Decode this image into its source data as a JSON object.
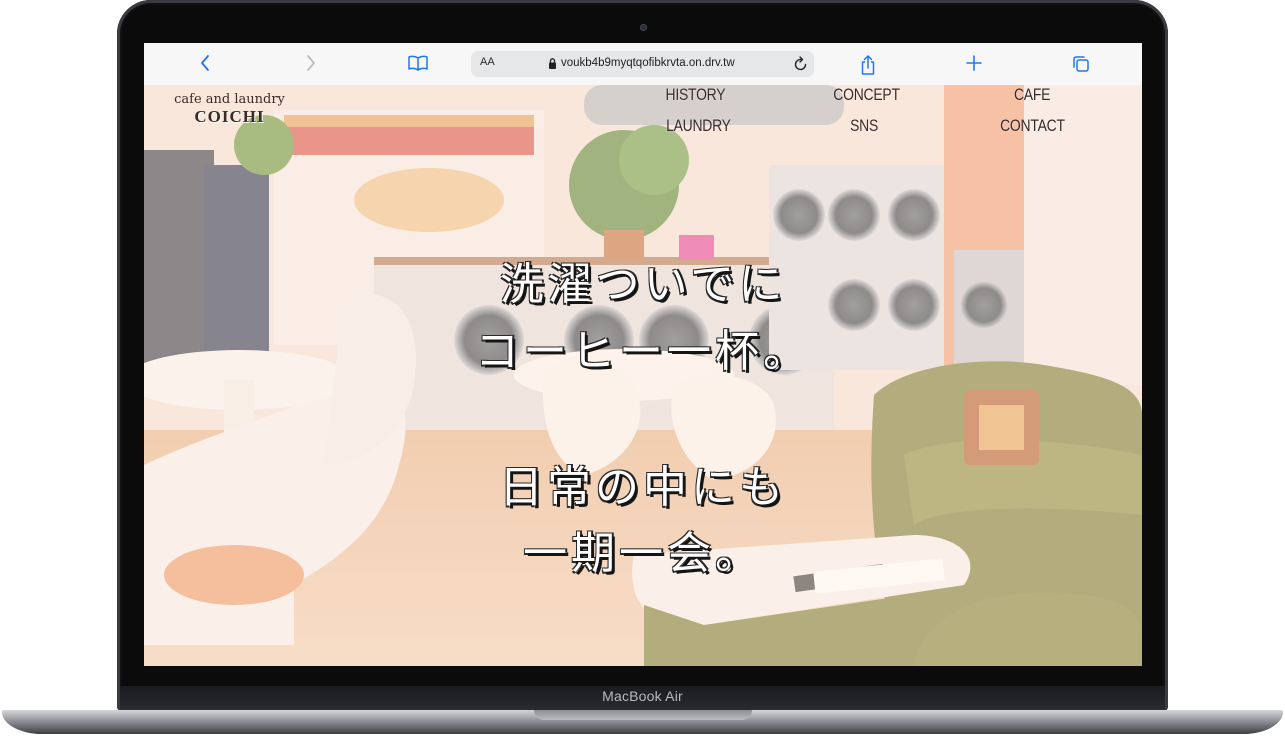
{
  "device": {
    "brand_label": "MacBook Air"
  },
  "browser": {
    "text_size_label": "AA",
    "url": "voukb4b9myqtqofibkrvta.on.drv.tw",
    "icons": {
      "back": "chevron-left-icon",
      "forward": "chevron-right-icon",
      "bookmarks": "book-icon",
      "lock": "lock-icon",
      "reload": "reload-icon",
      "share": "share-icon",
      "new_tab": "plus-icon",
      "tabs": "tabs-icon"
    },
    "accent_color": "#1e78ec"
  },
  "site": {
    "logo": {
      "tagline": "cafe and laundry",
      "name": "COICHI"
    },
    "nav": {
      "history": "HISTORY",
      "concept": "CONCEPT",
      "cafe": "CAFE",
      "laundry": "LAUNDRY",
      "sns": "SNS",
      "contact": "CONTACT"
    },
    "hero": {
      "line1": "洗濯ついでに",
      "line2": "コーヒー一杯。",
      "line3": "日常の中にも",
      "line4": "一期一会。"
    }
  }
}
